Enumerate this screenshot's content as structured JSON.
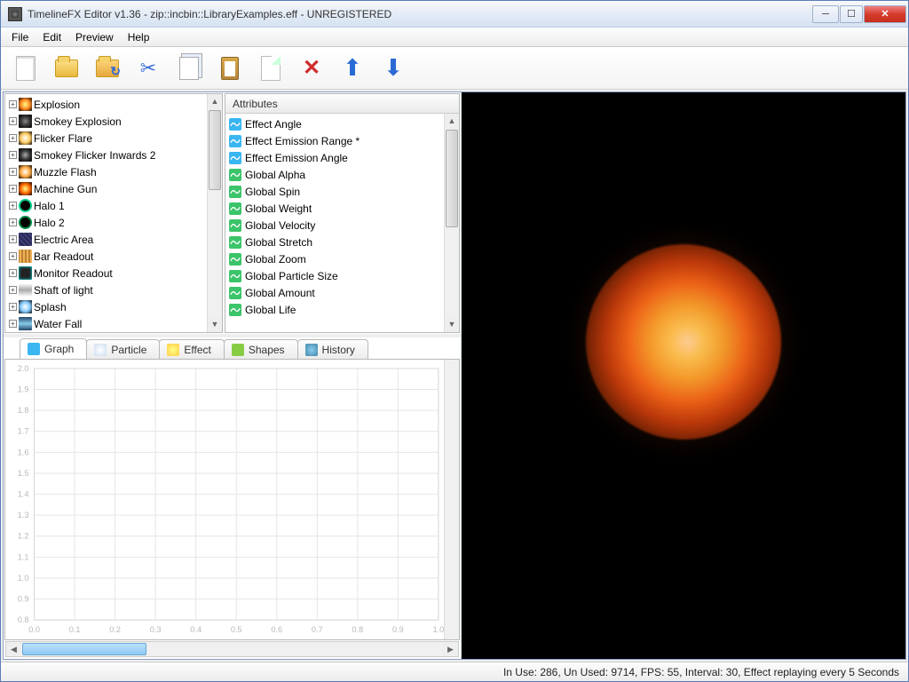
{
  "window": {
    "title": "TimelineFX Editor v1.36 - zip::incbin::LibraryExamples.eff - UNREGISTERED"
  },
  "menu": {
    "file": "File",
    "edit": "Edit",
    "preview": "Preview",
    "help": "Help"
  },
  "tree": {
    "items": [
      {
        "label": "Explosion",
        "thumb": "t0"
      },
      {
        "label": "Smokey Explosion",
        "thumb": "t1"
      },
      {
        "label": "Flicker Flare",
        "thumb": "t2"
      },
      {
        "label": "Smokey Flicker Inwards 2",
        "thumb": "t3"
      },
      {
        "label": "Muzzle Flash",
        "thumb": "t4"
      },
      {
        "label": "Machine Gun",
        "thumb": "t5"
      },
      {
        "label": "Halo 1",
        "thumb": "t6"
      },
      {
        "label": "Halo 2",
        "thumb": "t7"
      },
      {
        "label": "Electric Area",
        "thumb": "t8"
      },
      {
        "label": "Bar Readout",
        "thumb": "t9"
      },
      {
        "label": "Monitor Readout",
        "thumb": "t10"
      },
      {
        "label": "Shaft of light",
        "thumb": "t11"
      },
      {
        "label": "Splash",
        "thumb": "t12"
      },
      {
        "label": "Water Fall",
        "thumb": "t13"
      }
    ]
  },
  "attributes": {
    "header": "Attributes",
    "items": [
      {
        "label": "Effect Angle",
        "color": "blue"
      },
      {
        "label": "Effect Emission Range *",
        "color": "blue"
      },
      {
        "label": "Effect Emission Angle",
        "color": "blue"
      },
      {
        "label": "Global Alpha",
        "color": "green"
      },
      {
        "label": "Global Spin",
        "color": "green"
      },
      {
        "label": "Global Weight",
        "color": "green"
      },
      {
        "label": "Global Velocity",
        "color": "green"
      },
      {
        "label": "Global Stretch",
        "color": "green"
      },
      {
        "label": "Global Zoom",
        "color": "green"
      },
      {
        "label": "Global Particle Size",
        "color": "green"
      },
      {
        "label": "Global Amount",
        "color": "green"
      },
      {
        "label": "Global Life",
        "color": "green"
      }
    ]
  },
  "tabs": {
    "graph": "Graph",
    "particle": "Particle",
    "effect": "Effect",
    "shapes": "Shapes",
    "history": "History"
  },
  "chart_data": {
    "type": "line",
    "title": "",
    "xlabel": "",
    "ylabel": "",
    "xlim": [
      0.0,
      1.0
    ],
    "ylim": [
      0.8,
      2.0
    ],
    "xticks": [
      0.0,
      0.1,
      0.2,
      0.3,
      0.4,
      0.5,
      0.6,
      0.7,
      0.8,
      0.9,
      1.0
    ],
    "yticks": [
      0.8,
      0.9,
      1.0,
      1.1,
      1.2,
      1.3,
      1.4,
      1.5,
      1.6,
      1.7,
      1.8,
      1.9,
      2.0
    ],
    "series": []
  },
  "status": {
    "text": "In Use: 286, Un Used: 9714, FPS: 55, Interval: 30, Effect replaying every 5 Seconds"
  }
}
